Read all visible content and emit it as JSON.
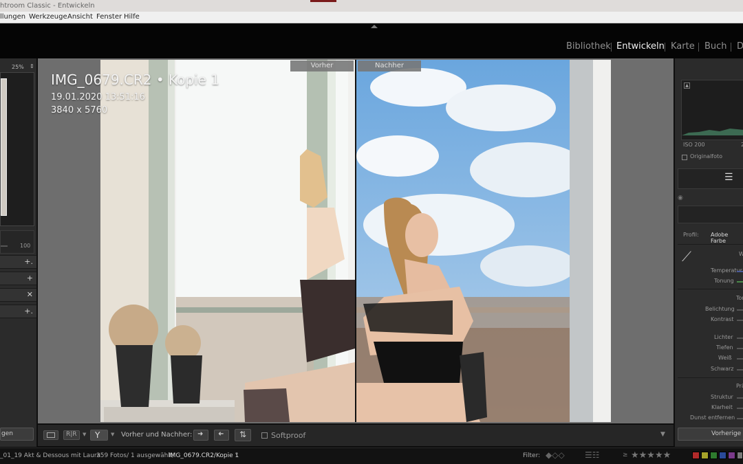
{
  "titlebar": {
    "title": "htroom Classic - Entwickeln"
  },
  "menu": {
    "items": [
      "llungen",
      "Werkzeuge",
      "Ansicht",
      "Fenster",
      "Hilfe"
    ]
  },
  "modules": [
    "Bibliothek",
    "Entwickeln",
    "Karte",
    "Buch",
    "D"
  ],
  "active_module": "Entwickeln",
  "left_panel": {
    "zoom": "25%",
    "slider_max": "100",
    "import_label": "gen"
  },
  "view": {
    "before_label": "Vorher",
    "after_label": "Nachher",
    "filename": "IMG_0679.CR2  •  Kopie 1",
    "date": "19.01.2020 13:51:16",
    "dimensions": "3840 x 5760"
  },
  "toolbar": {
    "before_after_label": "Vorher und Nachher:",
    "softproof_label": "Softproof"
  },
  "right_panel": {
    "iso": "ISO 200",
    "iso_next": "2",
    "originalfoto": "Originalfoto",
    "profile_label": "Profil:",
    "profile_value": "Adobe Farbe",
    "wb_head": "W",
    "temperature": "Temperatur",
    "tint": "Tonung",
    "tone_head": "Ton",
    "exposure": "Belichtung",
    "contrast": "Kontrast",
    "highlights": "Lichter",
    "shadows": "Tiefen",
    "whites": "Weiß",
    "blacks": "Schwarz",
    "presence_head": "Prä",
    "texture": "Struktur",
    "clarity": "Klarheit",
    "dehaze": "Dunst entfernen",
    "previous_button": "Vorherige"
  },
  "filmstrip": {
    "folder": "_01_19 Akt & Dessous mit Laura",
    "count": "359 Fotos/ 1 ausgewählt/",
    "current": "IMG_0679.CR2/Kopie 1",
    "filter_label": "Filter:",
    "rating_op": "≥"
  },
  "colors": {
    "label_red": "#b02a2a",
    "label_yellow": "#a6a22a",
    "label_green": "#2e7a2e",
    "label_blue": "#2a4a9a",
    "label_purple": "#7a3a8a",
    "label_gray": "#777777"
  }
}
